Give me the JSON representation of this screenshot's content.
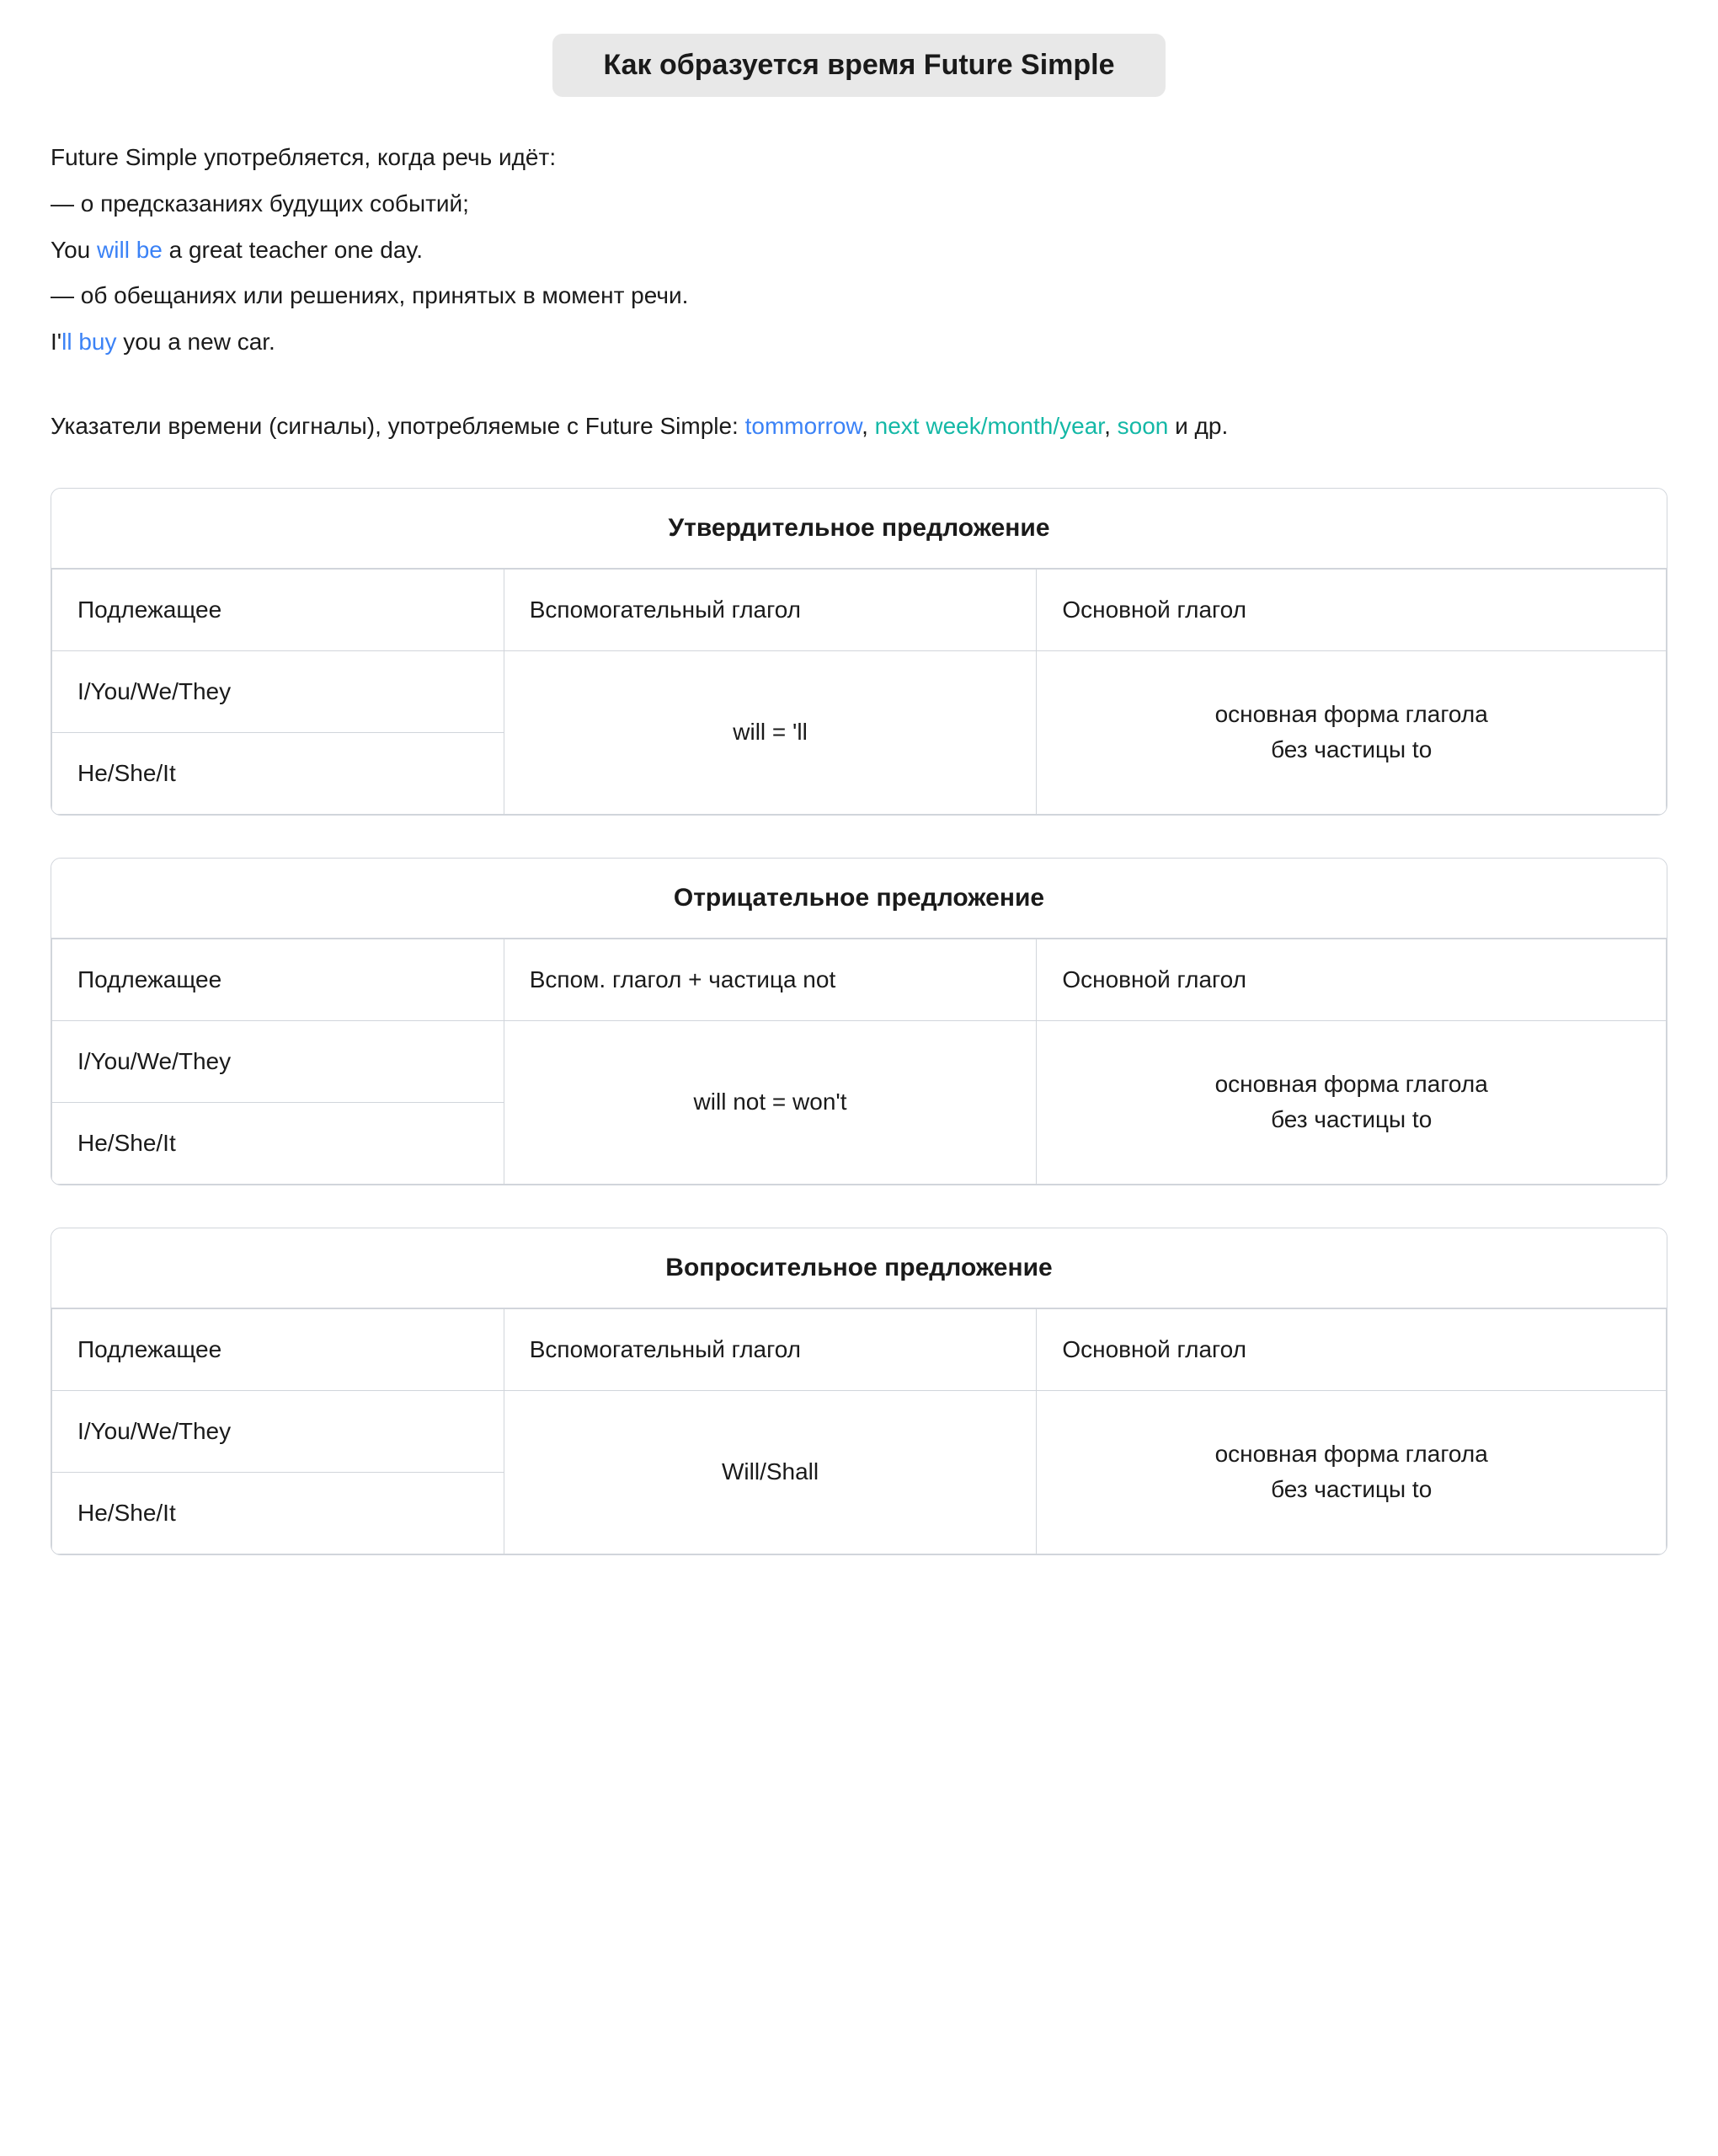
{
  "page": {
    "title": "Как образуется время Future Simple"
  },
  "intro": {
    "line1": "Future Simple употребляется, когда речь идёт:",
    "line2": "— о предсказаниях будущих событий;",
    "line3_prefix": "You ",
    "line3_highlight": "will be",
    "line3_suffix": " a great teacher one day.",
    "line4": "— об обещаниях или решениях, принятых в момент речи.",
    "line5_prefix": "I'",
    "line5_highlight": "ll buy",
    "line5_suffix": " you a new car.",
    "signals_prefix": "Указатели времени (сигналы), употребляемые с Future Simple: ",
    "signals_1": "tommorrow",
    "signals_2": ", ",
    "signals_3": "next week",
    "signals_4": "/",
    "signals_5": "month",
    "signals_6": "/",
    "signals_7": "year",
    "signals_8": ", ",
    "signals_9": "soon",
    "signals_10": " и др."
  },
  "affirmative": {
    "section_title": "Утвердительное предложение",
    "col1_header": "Подлежащее",
    "col2_header": "Вспомогательный глагол",
    "col3_header": "Основной глагол",
    "subject1": "I/You/We/They",
    "subject2": "He/She/It",
    "aux_verb": "will = 'll",
    "main_verb_line1": "основная форма глагола",
    "main_verb_line2": "без частицы to"
  },
  "negative": {
    "section_title": "Отрицательное предложение",
    "col1_header": "Подлежащее",
    "col2_header": "Вспом. глагол + частица not",
    "col3_header": "Основной глагол",
    "subject1": "I/You/We/They",
    "subject2": "He/She/It",
    "aux_verb": "will not = won't",
    "main_verb_line1": "основная форма глагола",
    "main_verb_line2": "без частицы to"
  },
  "interrogative": {
    "section_title": "Вопросительное предложение",
    "col1_header": "Подлежащее",
    "col2_header": "Вспомогательный глагол",
    "col3_header": "Основной глагол",
    "subject1": "I/You/We/They",
    "subject2": "He/She/It",
    "aux_verb": "Will/Shall",
    "main_verb_line1": "основная форма глагола",
    "main_verb_line2": "без частицы to"
  }
}
